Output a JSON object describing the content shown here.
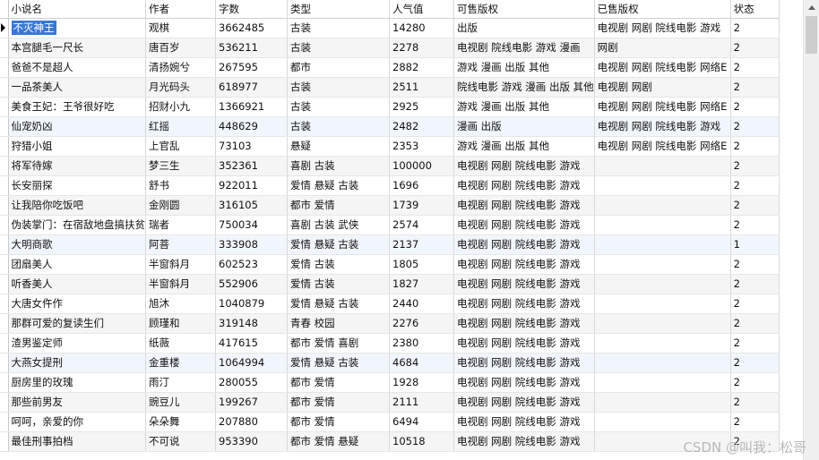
{
  "columns": [
    "小说名",
    "作者",
    "字数",
    "类型",
    "人气值",
    "可售版权",
    "已售版权",
    "状态"
  ],
  "rows": [
    [
      "不灭神王",
      "观棋",
      "3662485",
      "古装",
      "14280",
      "出版",
      "电视剧 网剧 院线电影 游戏",
      "2"
    ],
    [
      "本宫腿毛一尺长",
      "唐百岁",
      "536211",
      "古装",
      "2278",
      "电视剧 院线电影 游戏 漫画",
      "网剧",
      "2"
    ],
    [
      "爸爸不是超人",
      "清扬婉兮",
      "267595",
      "都市",
      "2882",
      "游戏 漫画 出版 其他",
      "电视剧 网剧 院线电影 网络E",
      "2"
    ],
    [
      "一品茶美人",
      "月光码头",
      "618977",
      "古装",
      "2511",
      "院线电影 游戏 漫画 出版 其他",
      "电视剧 网剧",
      "2"
    ],
    [
      "美食王妃：王爷很好吃",
      "招财小九",
      "1366921",
      "古装",
      "2925",
      "游戏 漫画 出版 其他",
      "电视剧 网剧 院线电影 网络E",
      "2"
    ],
    [
      "仙宠奶凶",
      "红摇",
      "448629",
      "古装",
      "2482",
      "漫画 出版",
      "电视剧 网剧 院线电影 游戏",
      "2"
    ],
    [
      "狩猎小姐",
      "上官乱",
      "73103",
      "悬疑",
      "2353",
      "游戏 漫画 出版 其他",
      "电视剧 网剧 院线电影 网络E",
      "2"
    ],
    [
      "将军待嫁",
      "梦三生",
      "352361",
      "喜剧 古装",
      "100000",
      "电视剧 网剧 院线电影 游戏",
      "",
      "2"
    ],
    [
      "长安丽探",
      "舒书",
      "922011",
      "爱情 悬疑 古装",
      "1696",
      "电视剧 网剧 院线电影 游戏",
      "",
      "2"
    ],
    [
      "让我陪你吃饭吧",
      "金刚圆",
      "316105",
      "都市 爱情",
      "1739",
      "电视剧 网剧 院线电影 游戏",
      "",
      "2"
    ],
    [
      "伪装掌门：在宿敌地盘搞扶贫",
      "瑞者",
      "750034",
      "喜剧 古装 武侠",
      "2574",
      "电视剧 网剧 院线电影 游戏",
      "",
      "2"
    ],
    [
      "大明商歌",
      "阿菩",
      "333908",
      "爱情 悬疑 古装",
      "2137",
      "电视剧 网剧 院线电影 游戏",
      "",
      "1"
    ],
    [
      "团扇美人",
      "半窗斜月",
      "602523",
      "爱情 古装",
      "1805",
      "电视剧 网剧 院线电影 游戏",
      "",
      "2"
    ],
    [
      "听香美人",
      "半窗斜月",
      "552906",
      "爱情 古装",
      "1827",
      "电视剧 网剧 院线电影 游戏",
      "",
      "2"
    ],
    [
      "大唐女仵作",
      "旭沐",
      "1040879",
      "爱情 悬疑 古装",
      "2440",
      "电视剧 网剧 院线电影 游戏",
      "",
      "2"
    ],
    [
      "那群可爱的复读生们",
      "顾瑾和",
      "319148",
      "青春 校园",
      "2276",
      "电视剧 网剧 院线电影 游戏",
      "",
      "2"
    ],
    [
      "渣男鉴定师",
      "纸薇",
      "417615",
      "都市 爱情 喜剧",
      "2380",
      "电视剧 网剧 院线电影 游戏",
      "",
      "2"
    ],
    [
      "大燕女提刑",
      "金重楼",
      "1064994",
      "爱情 悬疑 古装",
      "4684",
      "电视剧 网剧 院线电影 游戏",
      "",
      "2"
    ],
    [
      "厨房里的玫瑰",
      "雨汀",
      "280055",
      "都市 爱情",
      "1928",
      "电视剧 网剧 院线电影 游戏",
      "",
      "2"
    ],
    [
      "那些前男友",
      "豌豆儿",
      "199267",
      "都市 爱情",
      "2111",
      "电视剧 网剧 院线电影 游戏",
      "",
      "2"
    ],
    [
      "呵呵，亲爱的你",
      "朵朵舞",
      "207880",
      "都市 爱情",
      "6494",
      "电视剧 网剧 院线电影 游戏",
      "",
      "2"
    ],
    [
      "最佳刑事拍档",
      "不可说",
      "953390",
      "都市 爱情 悬疑",
      "10518",
      "电视剧 网剧 院线电影 游戏",
      "",
      "2"
    ]
  ],
  "watermark": "CSDN @叫我：松哥"
}
